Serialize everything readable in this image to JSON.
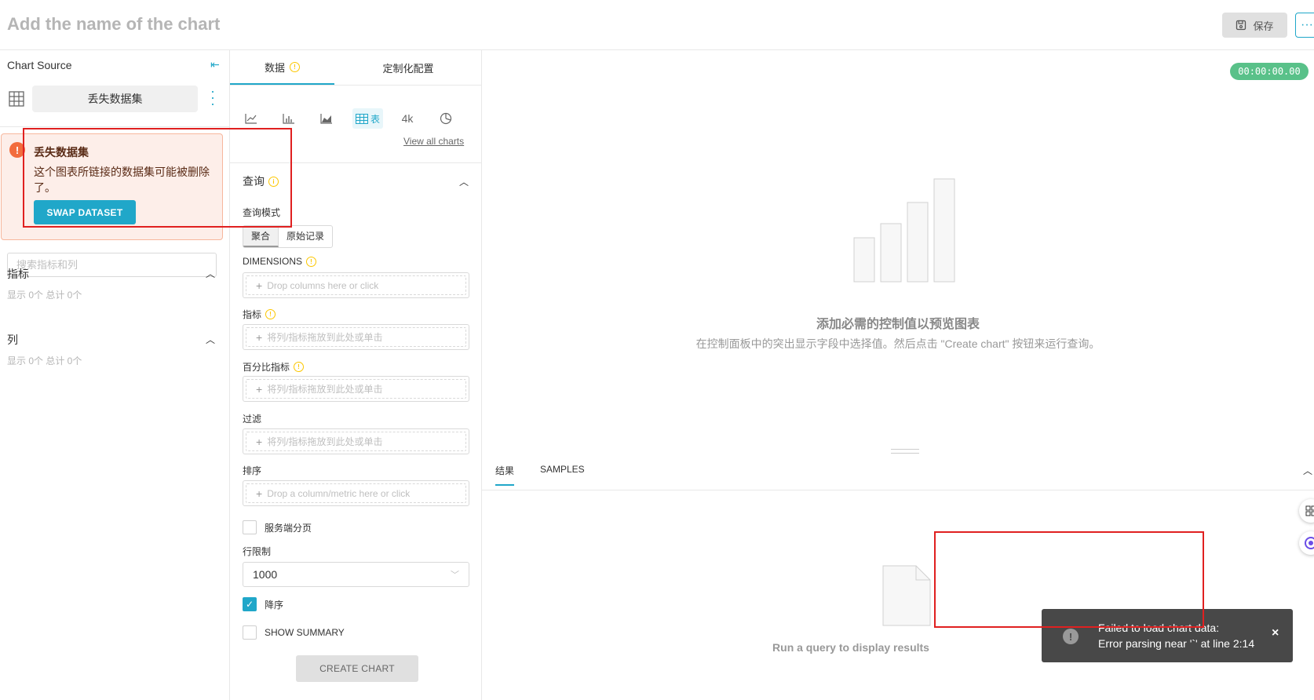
{
  "header": {
    "title_placeholder": "Add the name of the chart",
    "save_label": "保存",
    "more_label": "···"
  },
  "sidebar": {
    "source_label": "Chart Source",
    "dataset_name": "丢失数据集",
    "alert": {
      "title": "丢失数据集",
      "message": "这个图表所链接的数据集可能被删除了。",
      "button": "SWAP DATASET"
    },
    "search_placeholder": "搜索指标和列",
    "metrics": {
      "title": "指标",
      "count": "显示 0个 总计 0个"
    },
    "columns": {
      "title": "列",
      "count": "显示 0个 总计 0个"
    }
  },
  "control_panel": {
    "tabs": [
      {
        "label": "数据",
        "active": true
      },
      {
        "label": "定制化配置",
        "active": false
      }
    ],
    "viz_types": [
      {
        "icon": "line-chart-icon"
      },
      {
        "icon": "bar-chart-icon"
      },
      {
        "icon": "area-chart-icon"
      },
      {
        "icon": "table-icon",
        "label": "表",
        "selected": true
      },
      {
        "icon": "big-number-icon",
        "label": "4k"
      },
      {
        "icon": "pie-chart-icon"
      }
    ],
    "view_all": "View all charts",
    "query": {
      "title": "查询",
      "mode_label": "查询模式",
      "mode_options": [
        "聚合",
        "原始记录"
      ],
      "dimensions_label": "DIMENSIONS",
      "dimensions_placeholder": "Drop columns here or click",
      "metrics_label": "指标",
      "metrics_placeholder": "将列/指标拖放到此处或单击",
      "percent_metrics_label": "百分比指标",
      "percent_metrics_placeholder": "将列/指标拖放到此处或单击",
      "filters_label": "过滤",
      "filters_placeholder": "将列/指标拖放到此处或单击",
      "sort_label": "排序",
      "sort_placeholder": "Drop a column/metric here or click",
      "server_pagination_label": "服务端分页",
      "row_limit_label": "行限制",
      "row_limit_value": "1000",
      "descending_label": "降序",
      "show_summary_label": "SHOW SUMMARY",
      "create_chart": "CREATE CHART"
    }
  },
  "chart_area": {
    "timer": "00:00:00.00",
    "empty_title": "添加必需的控制值以预览图表",
    "empty_desc": "在控制面板中的突出显示字段中选择值。然后点击 \"Create chart\" 按钮来运行查询。",
    "result_tabs": [
      "结果",
      "SAMPLES"
    ],
    "run_query_msg": "Run a query to display results"
  },
  "toast": {
    "line1": "Failed to load chart data:",
    "line2": "Error parsing near '`' at line 2:14",
    "close": "×"
  },
  "colors": {
    "accent": "#20a7c9",
    "alert_bg": "#fdeee9",
    "timer_bg": "#59c189",
    "toast_bg": "#484848",
    "annotation_red": "#e02020"
  }
}
